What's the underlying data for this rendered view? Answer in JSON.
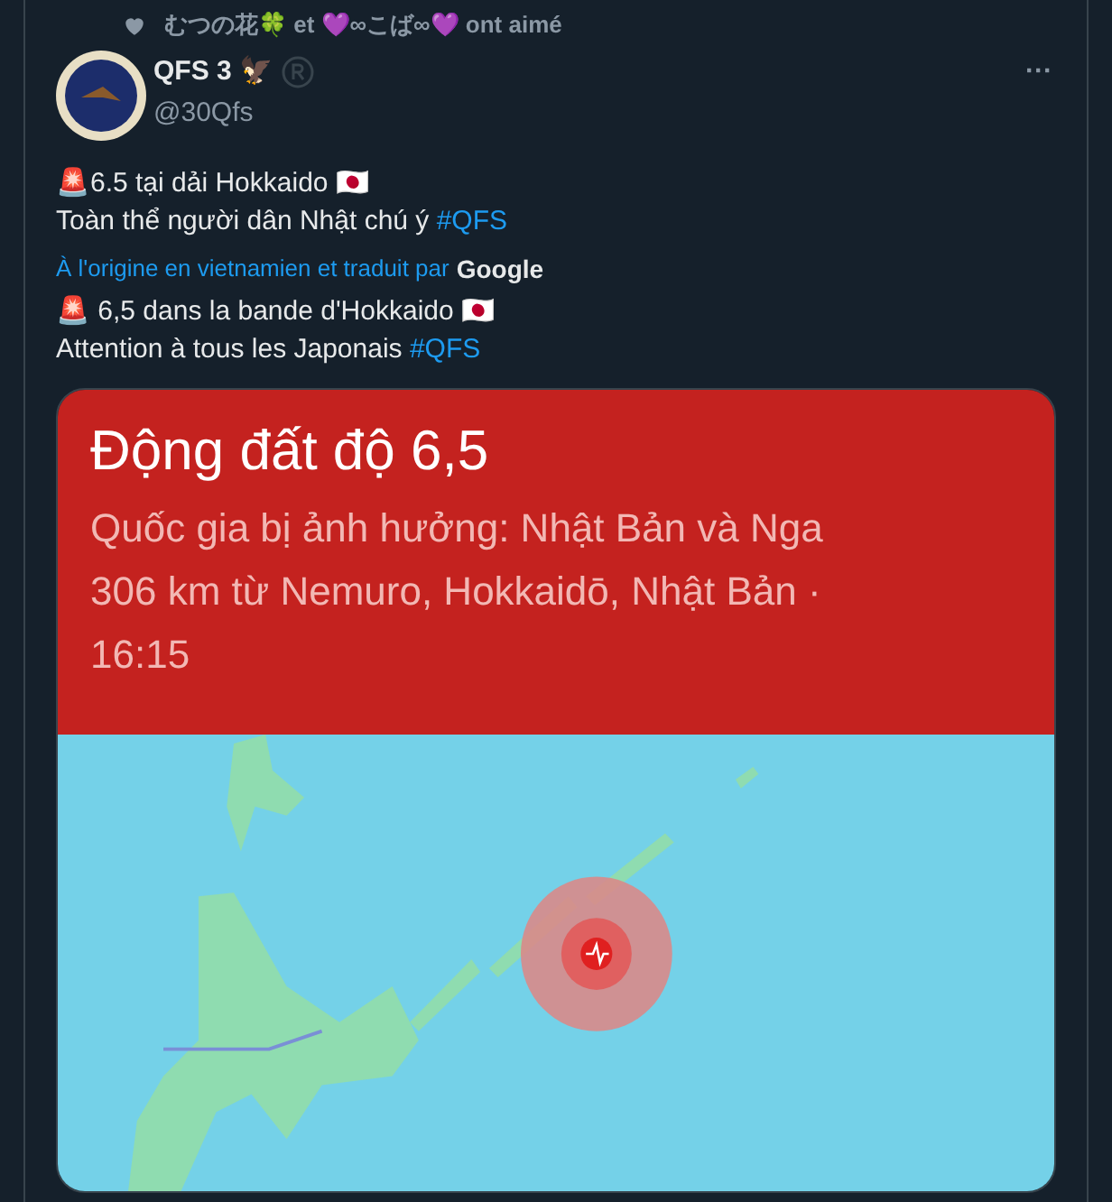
{
  "social_context": "むつの花🍀 et 💜∞こば∞💜 ont aimé",
  "author": {
    "name": "QFS 3 🦅",
    "handle": "@30Qfs"
  },
  "more_button": "···",
  "original_text": [
    {
      "text": "🚨6.5 tại dải Hokkaido 🇯🇵"
    },
    {
      "text": "Toàn thể người dân Nhật chú ý ",
      "hashtag": "#QFS"
    }
  ],
  "translation_note": {
    "text": "À l'origine en vietnamien et traduit par",
    "provider": "Google"
  },
  "translated_text": [
    {
      "text": "🚨 6,5 dans la bande d'Hokkaido 🇯🇵"
    },
    {
      "text": "Attention à tous les Japonais ",
      "hashtag": "#QFS"
    }
  ],
  "card": {
    "title": "Động đất độ 6,5",
    "lines": [
      "Quốc gia bị ảnh hưởng: Nhật Bản và Nga",
      "306 km từ Nemuro, Hokkaidō, Nhật Bản ·",
      "16:15"
    ]
  }
}
